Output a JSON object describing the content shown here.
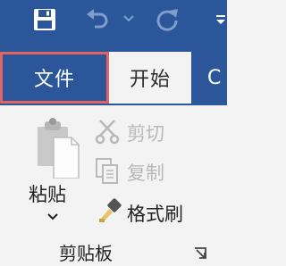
{
  "colors": {
    "ribbon_blue": "#2b579a",
    "highlight_border": "#e16464",
    "ribbon_bg": "#f3f3f3",
    "disabled_text": "#b9b9b9"
  },
  "quick_access": {
    "icons": [
      "save-icon",
      "undo-icon",
      "undo-dropdown-icon",
      "redo-icon",
      "customize-qat-icon"
    ]
  },
  "tabs": {
    "file": "文件",
    "home": "开始",
    "partial": "C"
  },
  "clipboard": {
    "paste_label": "粘贴",
    "cut_label": "剪切",
    "copy_label": "复制",
    "format_painter_label": "格式刷",
    "group_label": "剪贴板"
  }
}
